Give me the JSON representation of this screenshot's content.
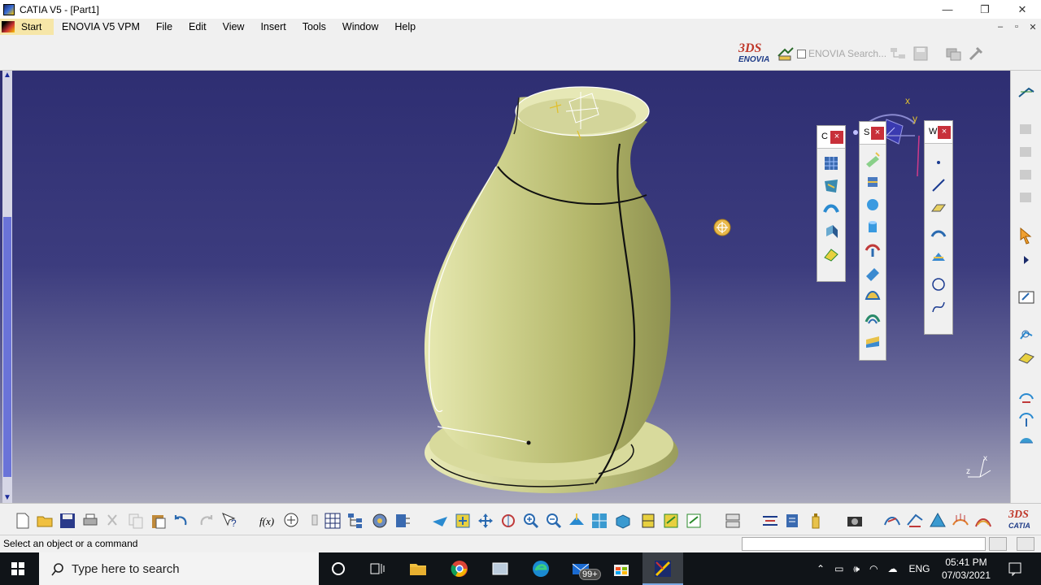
{
  "window": {
    "title": "CATIA V5 - [Part1]",
    "minimize": "—",
    "maximize": "❐",
    "close": "✕"
  },
  "menu": {
    "start": "Start",
    "items": [
      "ENOVIA V5 VPM",
      "File",
      "Edit",
      "View",
      "Insert",
      "Tools",
      "Window",
      "Help"
    ],
    "mdi_minimize": "–",
    "mdi_restore": "▫",
    "mdi_close": "✕"
  },
  "top_toolbar": {
    "logo_ds": "3DS",
    "logo_enovia": "ENOVIA",
    "enovia_search": "ENOVIA Search..."
  },
  "viewport": {
    "compass_x": "x",
    "compass_y": "y",
    "axis_x": "x",
    "axis_z": "z"
  },
  "float_toolbars": [
    {
      "header": "C",
      "close": "×"
    },
    {
      "header": "S",
      "close": "×"
    },
    {
      "header": "W",
      "close": "×"
    }
  ],
  "catia_logo": {
    "ds": "3DS",
    "name": "CATIA"
  },
  "status": {
    "message": "Select an object or a command"
  },
  "taskbar": {
    "search_placeholder": "Type here to search",
    "mail_badge": "99+",
    "language": "ENG",
    "time": "05:41 PM",
    "date": "07/03/2021"
  },
  "colors": {
    "viewport_top": "#2e2e72",
    "viewport_bottom": "#a9a9bc",
    "surface": "#c9cc8a",
    "close_red": "#c8303a"
  }
}
